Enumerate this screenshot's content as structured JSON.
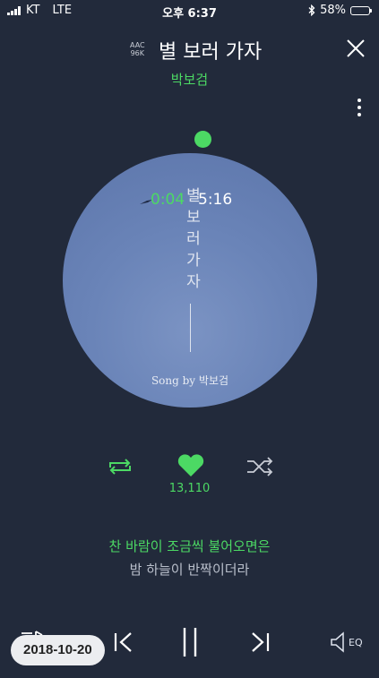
{
  "status_bar": {
    "carrier": "KT",
    "network": "LTE",
    "time": "오후 6:37",
    "battery": "58%",
    "battery_level": 0.58
  },
  "header": {
    "codec_line1": "AAC",
    "codec_line2": "96K",
    "title": "별 보러 가자",
    "artist": "박보검"
  },
  "album_art": {
    "title_text": "별보러가자",
    "credit": "Song by 박보검"
  },
  "playback": {
    "elapsed": "0:04",
    "total": "5:16",
    "progress_fraction": 0.013
  },
  "like": {
    "count": "13,110"
  },
  "lyrics": {
    "current": "찬 바람이 조금씩 불어오면은",
    "next": "밤 하늘이 반짝이더라"
  },
  "controls": {
    "eq_label": "EQ"
  },
  "overlay": {
    "date": "2018-10-20"
  },
  "colors": {
    "accent": "#4cd964",
    "background": "#222a3b",
    "album": "#6a84b8"
  },
  "icons": [
    "signal-icon",
    "bluetooth-icon",
    "battery-icon",
    "close-icon",
    "more-icon",
    "repeat-icon",
    "heart-icon",
    "shuffle-icon",
    "playlist-icon",
    "prev-icon",
    "pause-icon",
    "next-icon",
    "speaker-eq-icon"
  ]
}
